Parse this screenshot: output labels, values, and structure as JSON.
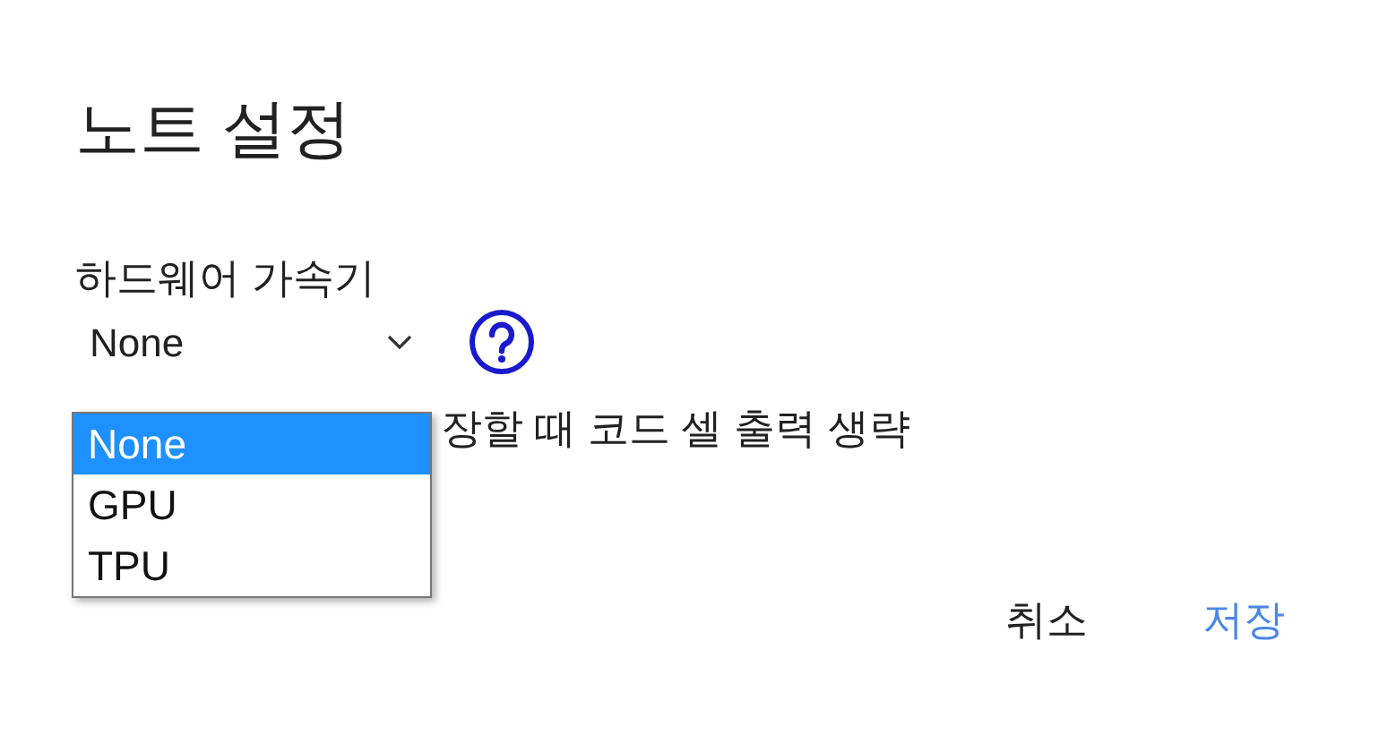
{
  "dialog": {
    "title": "노트 설정",
    "accelerator": {
      "label": "하드웨어 가속기",
      "value": "None",
      "options": [
        {
          "label": "None",
          "selected": true
        },
        {
          "label": "GPU",
          "selected": false
        },
        {
          "label": "TPU",
          "selected": false
        }
      ]
    },
    "option_text": "장할 때 코드 셀 출력 생략",
    "buttons": [
      {
        "label": "취소",
        "kind": "plain"
      },
      {
        "label": "저장",
        "kind": "primary"
      }
    ]
  }
}
